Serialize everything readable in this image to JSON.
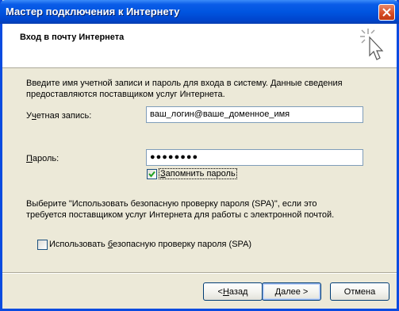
{
  "window": {
    "title": "Мастер подключения к Интернету"
  },
  "header": {
    "title": "Вход в почту Интернета",
    "icon": "wizard-cursor-icon"
  },
  "description": "Введите имя учетной записи и пароль для входа в систему. Данные сведения предоставляются поставщиком услуг Интернета.",
  "account": {
    "label_pre": "У",
    "label_hot": "ч",
    "label_post": "етная запись:",
    "value": "ваш_логин@ваше_доменное_имя"
  },
  "password": {
    "label_hot": "П",
    "label_post": "ароль:",
    "value": "●●●●●●●●"
  },
  "remember": {
    "label_hot": "З",
    "label_post": "апомнить пароль",
    "checked": true
  },
  "spa_note": "Выберите \"Использовать безопасную проверку пароля (SPA)\", если это требуется поставщиком услуг Интернета для работы с электронной почтой.",
  "spa": {
    "label_pre": "Использовать ",
    "label_hot": "б",
    "label_post": "езопасную проверку пароля (SPA)",
    "checked": false
  },
  "buttons": {
    "back_prefix": "< ",
    "back_hot": "Н",
    "back_post": "азад",
    "next_hot": "Д",
    "next_post": "алее >",
    "cancel": "Отмена"
  },
  "colors": {
    "titlebar": "#0055E0",
    "dialog_bg": "#ECE9D8",
    "input_border": "#7F9DB9",
    "check": "#21A121"
  }
}
